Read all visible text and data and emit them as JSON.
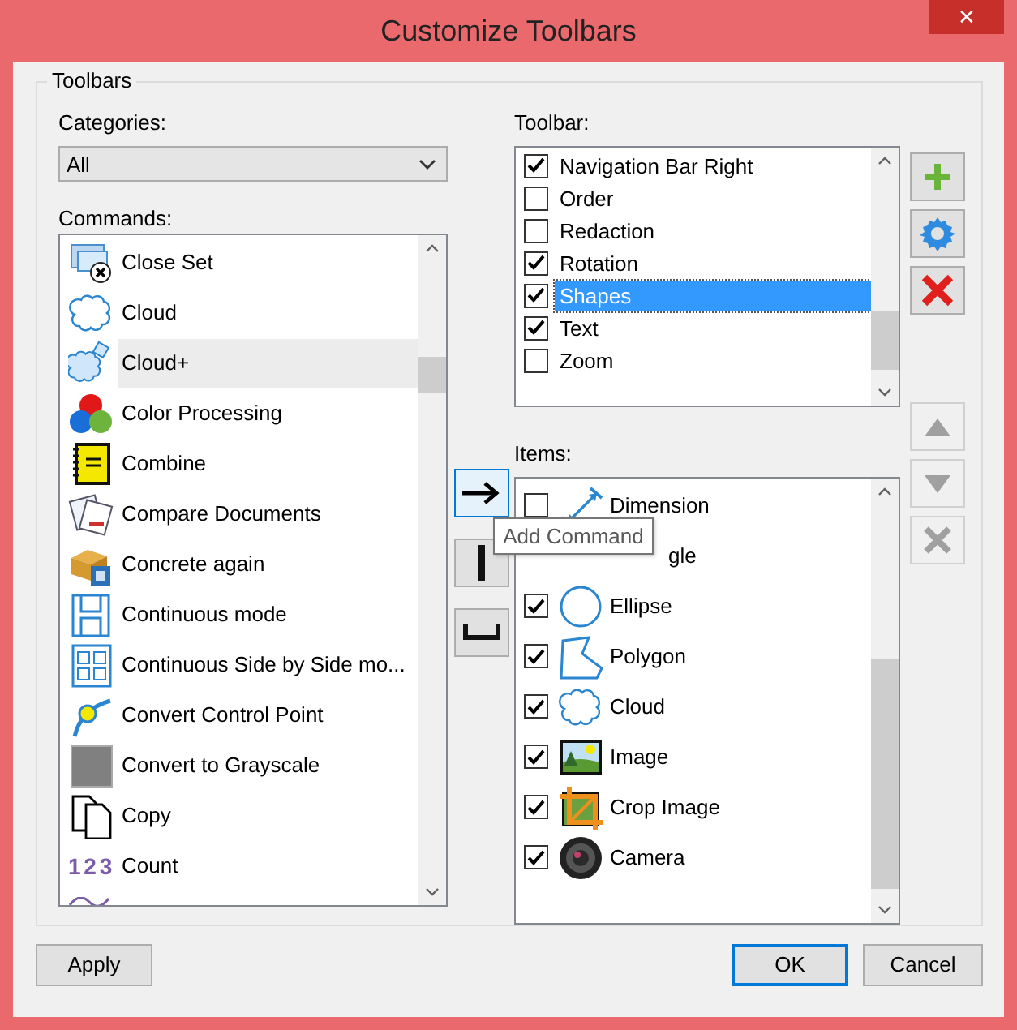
{
  "window": {
    "title": "Customize Toolbars",
    "close": "✕"
  },
  "group": {
    "title": "Toolbars"
  },
  "categories": {
    "label": "Categories:",
    "value": "All"
  },
  "commands": {
    "label": "Commands:",
    "items": [
      {
        "label": "Close Set",
        "selected": false
      },
      {
        "label": "Cloud",
        "selected": false
      },
      {
        "label": "Cloud+",
        "selected": true
      },
      {
        "label": "Color Processing",
        "selected": false
      },
      {
        "label": "Combine",
        "selected": false
      },
      {
        "label": "Compare Documents",
        "selected": false
      },
      {
        "label": "Concrete again",
        "selected": false
      },
      {
        "label": "Continuous mode",
        "selected": false
      },
      {
        "label": "Continuous Side by Side mo...",
        "selected": false
      },
      {
        "label": "Convert Control Point",
        "selected": false
      },
      {
        "label": "Convert to Grayscale",
        "selected": false
      },
      {
        "label": "Copy",
        "selected": false
      },
      {
        "label": "Count",
        "selected": false,
        "glyph": "1 2 3"
      }
    ]
  },
  "toolbar": {
    "label": "Toolbar:",
    "items": [
      {
        "label": "Navigation Bar Right",
        "checked": true,
        "selected": false
      },
      {
        "label": "Order",
        "checked": false,
        "selected": false
      },
      {
        "label": "Redaction",
        "checked": false,
        "selected": false
      },
      {
        "label": "Rotation",
        "checked": true,
        "selected": false
      },
      {
        "label": "Shapes",
        "checked": true,
        "selected": true
      },
      {
        "label": "Text",
        "checked": true,
        "selected": false
      },
      {
        "label": "Zoom",
        "checked": false,
        "selected": false
      }
    ]
  },
  "items": {
    "label": "Items:",
    "rows": [
      {
        "kind": "row",
        "label": "Dimension",
        "checked": false
      },
      {
        "kind": "covered",
        "label": "gle"
      },
      {
        "kind": "row",
        "label": "Ellipse",
        "checked": true
      },
      {
        "kind": "row",
        "label": "Polygon",
        "checked": true
      },
      {
        "kind": "row",
        "label": "Cloud",
        "checked": true
      },
      {
        "kind": "row",
        "label": "Image",
        "checked": true
      },
      {
        "kind": "row",
        "label": "Crop Image",
        "checked": true
      },
      {
        "kind": "row",
        "label": "Camera",
        "checked": true
      }
    ]
  },
  "tooltip": "Add Command",
  "buttons": {
    "apply": "Apply",
    "ok": "OK",
    "cancel": "Cancel"
  }
}
